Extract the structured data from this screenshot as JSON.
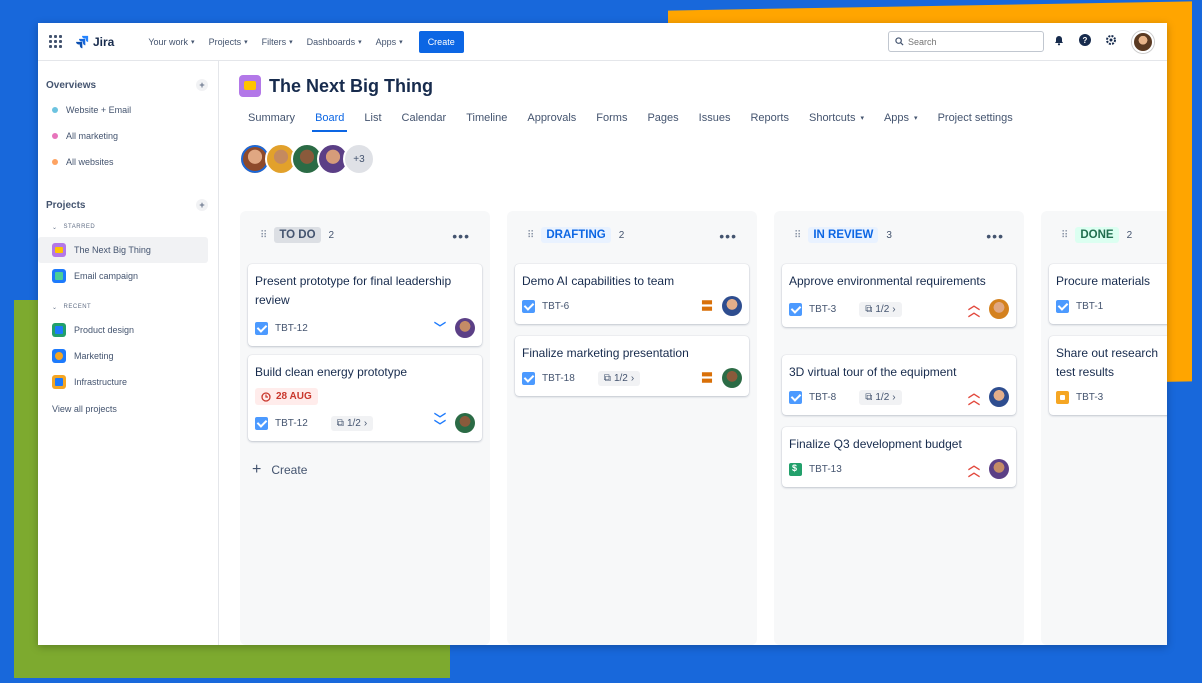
{
  "topnav": {
    "app_name": "Jira",
    "items": [
      {
        "label": "Your work"
      },
      {
        "label": "Projects"
      },
      {
        "label": "Filters"
      },
      {
        "label": "Dashboards"
      },
      {
        "label": "Apps"
      }
    ],
    "create_label": "Create",
    "search_placeholder": "Search"
  },
  "sidebar": {
    "overviews_title": "Overviews",
    "overviews": [
      {
        "label": "Website + Email",
        "color": "#6CC3E0"
      },
      {
        "label": "All marketing",
        "color": "#E774BB"
      },
      {
        "label": "All websites",
        "color": "#FEA362"
      }
    ],
    "projects_title": "Projects",
    "starred_label": "STARRED",
    "starred": [
      {
        "label": "The Next Big Thing"
      },
      {
        "label": "Email campaign"
      }
    ],
    "recent_label": "RECENT",
    "recent": [
      {
        "label": "Product design"
      },
      {
        "label": "Marketing"
      },
      {
        "label": "Infrastructure"
      }
    ],
    "view_all": "View all projects"
  },
  "project": {
    "title": "The Next Big Thing",
    "tabs": [
      "Summary",
      "Board",
      "List",
      "Calendar",
      "Timeline",
      "Approvals",
      "Forms",
      "Pages",
      "Issues",
      "Reports",
      "Shortcuts",
      "Apps",
      "Project settings"
    ],
    "extra_avatars": "+3"
  },
  "board": {
    "columns": [
      {
        "status": "TO DO",
        "count": "2",
        "bg": "#DCDFE4",
        "fg": "#44546F",
        "cards": [
          {
            "title": "Present prototype for final leadership review",
            "key": "TBT-12"
          },
          {
            "title": "Build clean energy prototype",
            "due": "28 AUG",
            "key": "TBT-12",
            "subtasks": "1/2"
          }
        ],
        "create_label": "Create"
      },
      {
        "status": "DRAFTING",
        "count": "2",
        "bg": "#E9F2FF",
        "fg": "#0C66E4",
        "cards": [
          {
            "title": "Demo AI capabilities to team",
            "key": "TBT-6"
          },
          {
            "title": "Finalize marketing presentation",
            "key": "TBT-18",
            "subtasks": "1/2"
          }
        ]
      },
      {
        "status": "IN REVIEW",
        "count": "3",
        "bg": "#E9F2FF",
        "fg": "#0C66E4",
        "cards": [
          {
            "title": "Approve environmental requirements",
            "key": "TBT-3",
            "subtasks": "1/2"
          },
          {
            "title": "3D virtual tour of the equipment",
            "key": "TBT-8",
            "subtasks": "1/2"
          },
          {
            "title": "Finalize Q3 development budget",
            "key": "TBT-13"
          }
        ]
      },
      {
        "status": "DONE",
        "count": "2",
        "bg": "#DCFFF1",
        "fg": "#216E4E",
        "cards": [
          {
            "title": "Procure materials",
            "key": "TBT-1"
          },
          {
            "title": "Share out research test results",
            "key": "TBT-3"
          }
        ]
      }
    ]
  }
}
